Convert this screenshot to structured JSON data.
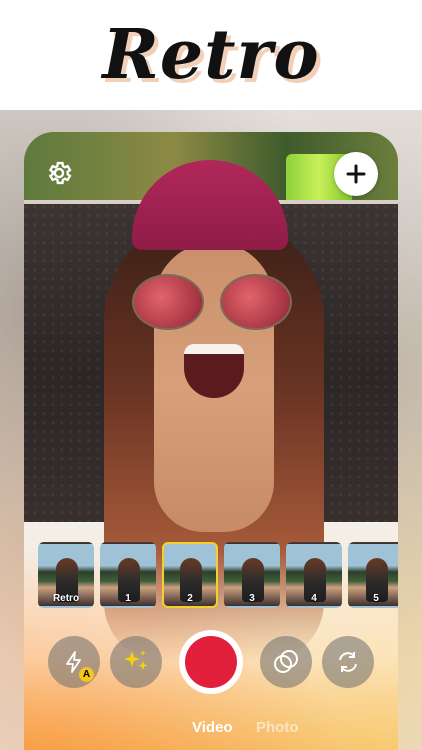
{
  "header": {
    "title": "Retro"
  },
  "top_controls": {
    "settings_icon": "gear-icon",
    "add_icon": "plus-icon"
  },
  "filters": [
    {
      "label": "Retro",
      "selected": false
    },
    {
      "label": "1",
      "selected": false
    },
    {
      "label": "2",
      "selected": true
    },
    {
      "label": "3",
      "selected": false
    },
    {
      "label": "4",
      "selected": false
    },
    {
      "label": "5",
      "selected": false
    }
  ],
  "controls": {
    "flash_icon": "flash-auto-icon",
    "flash_badge": "A",
    "effects_icon": "sparkles-icon",
    "record_icon": "record-button",
    "overlay_icon": "overlap-circles-icon",
    "flip_icon": "camera-flip-icon"
  },
  "modes": {
    "video": "Video",
    "photo": "Photo",
    "active": "Video"
  },
  "colors": {
    "record": "#e2203b",
    "selected_filter_border": "#f1d22b"
  }
}
